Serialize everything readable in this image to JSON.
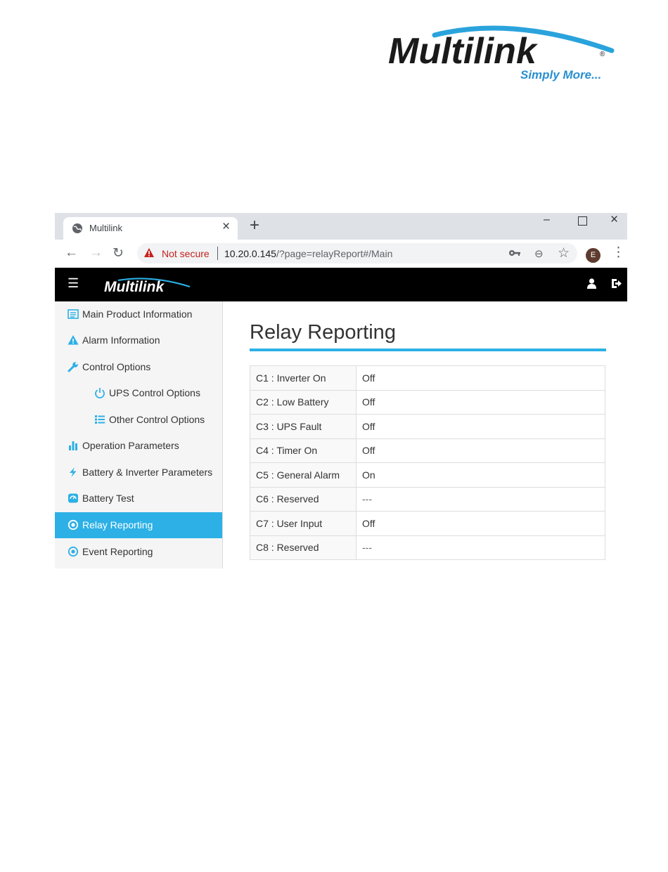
{
  "brand": {
    "name": "Multilink",
    "tagline": "Simply More..."
  },
  "browser": {
    "tab_title": "Multilink",
    "security_label": "Not secure",
    "url_host": "10.20.0.145",
    "url_path": "/?page=relayReport#/Main",
    "profile_initial": "E"
  },
  "app": {
    "logo_text": "Multilink"
  },
  "sidebar": {
    "items": [
      {
        "label": "Main Product Information",
        "icon": "list-icon"
      },
      {
        "label": "Alarm Information",
        "icon": "warning-icon"
      },
      {
        "label": "Control Options",
        "icon": "wrench-icon"
      },
      {
        "label": "UPS Control Options",
        "icon": "power-icon"
      },
      {
        "label": "Other Control Options",
        "icon": "list-bullets-icon"
      },
      {
        "label": "Operation Parameters",
        "icon": "bar-chart-icon"
      },
      {
        "label": "Battery & Inverter Parameters",
        "icon": "bolt-icon"
      },
      {
        "label": "Battery Test",
        "icon": "gauge-icon"
      },
      {
        "label": "Relay Reporting",
        "icon": "radio-dot-icon",
        "active": true
      },
      {
        "label": "Event Reporting",
        "icon": "radio-dot-icon"
      }
    ]
  },
  "main": {
    "title": "Relay Reporting",
    "rows": [
      {
        "label": "C1 : Inverter On",
        "value": "Off"
      },
      {
        "label": "C2 : Low Battery",
        "value": "Off"
      },
      {
        "label": "C3 : UPS Fault",
        "value": "Off"
      },
      {
        "label": "C4 : Timer On",
        "value": "Off"
      },
      {
        "label": "C5 : General Alarm",
        "value": "On"
      },
      {
        "label": "C6 : Reserved",
        "value": "---"
      },
      {
        "label": "C7 : User Input",
        "value": "Off"
      },
      {
        "label": "C8 : Reserved",
        "value": "---"
      }
    ]
  },
  "colors": {
    "accent": "#2cb0e6",
    "header": "#000000",
    "warning": "#c5221f"
  }
}
